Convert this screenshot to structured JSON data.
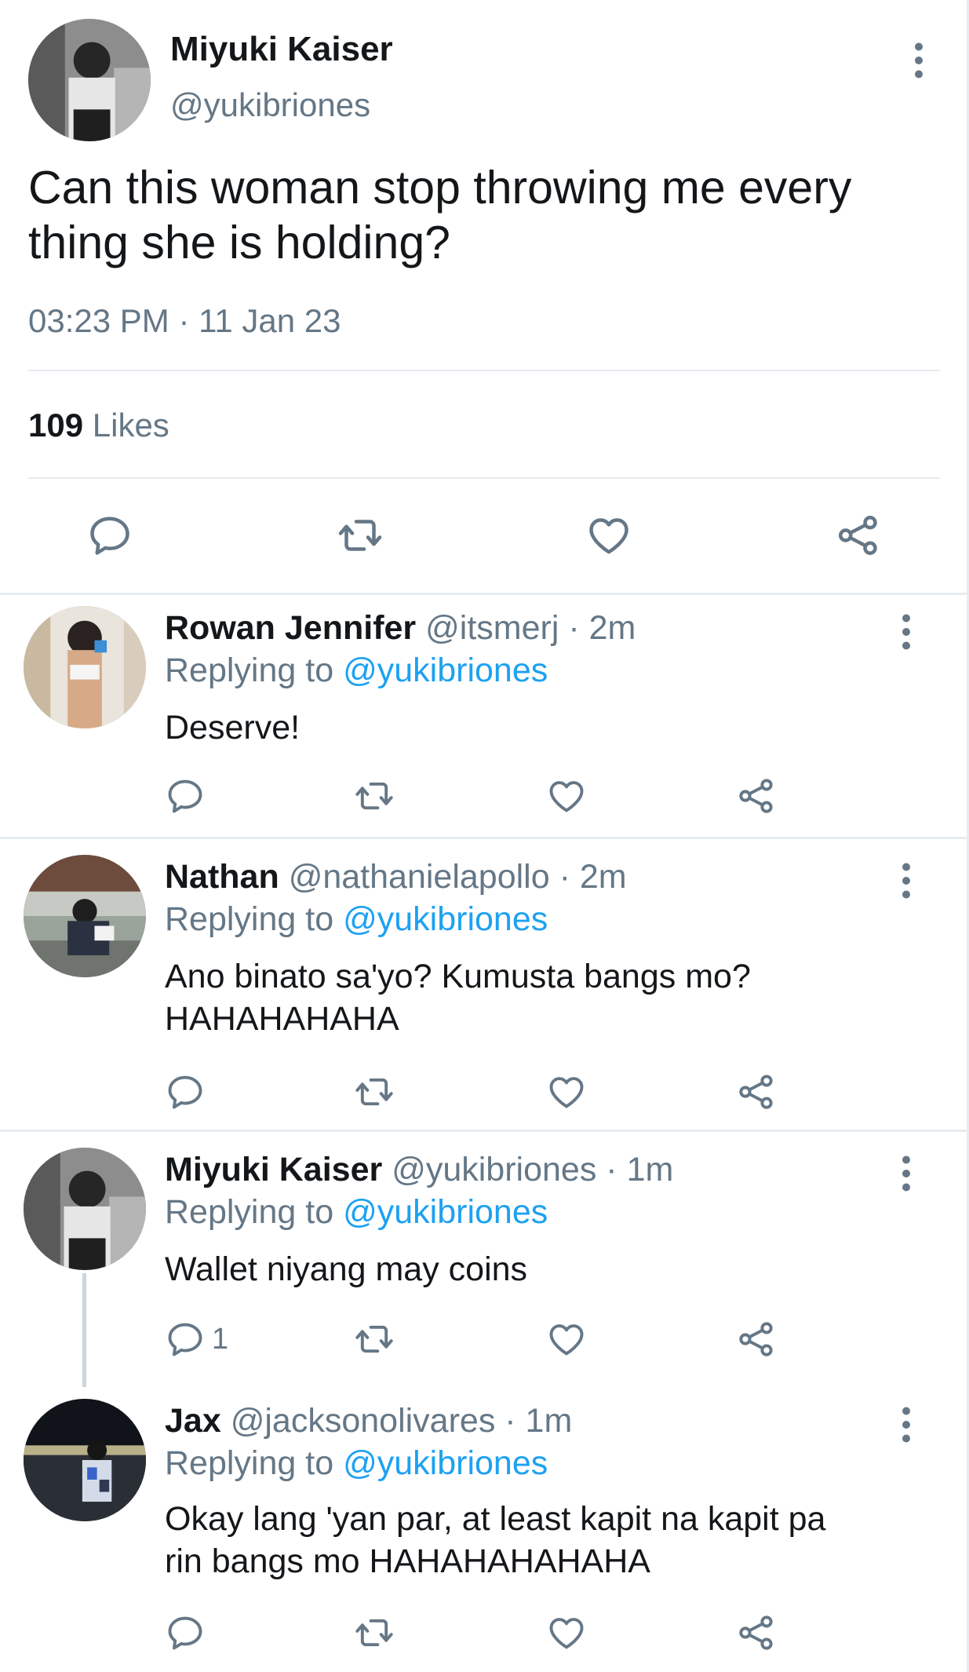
{
  "main_tweet": {
    "author_name": "Miyuki Kaiser",
    "author_handle": "@yukibriones",
    "text": "Can this woman stop throwing me every thing she is holding?",
    "timestamp": "03:23 PM · 11 Jan 23",
    "likes_count": "109",
    "likes_label": "Likes"
  },
  "replies": [
    {
      "name": "Rowan Jennifer",
      "handle": "@itsmerj",
      "time": "· 2m",
      "replying_label": "Replying to",
      "replying_to": "@yukibriones",
      "text": "Deserve!",
      "reply_count": ""
    },
    {
      "name": "Nathan",
      "handle": "@nathanielapollo",
      "time": "· 2m",
      "replying_label": "Replying to",
      "replying_to": "@yukibriones",
      "text": "Ano binato sa'yo? Kumusta bangs mo? HAHAHAHAHA",
      "reply_count": ""
    },
    {
      "name": "Miyuki Kaiser",
      "handle": "@yukibriones",
      "time": "· 1m",
      "replying_label": "Replying to",
      "replying_to": "@yukibriones",
      "text": "Wallet niyang may coins",
      "reply_count": "1"
    },
    {
      "name": "Jax",
      "handle": "@jacksonolivares",
      "time": "· 1m",
      "replying_label": "Replying to",
      "replying_to": "@yukibriones",
      "text": "Okay lang 'yan par, at least kapit na kapit pa rin bangs mo HAHAHAHAHAHA",
      "reply_count": ""
    }
  ],
  "colors": {
    "link": "#1da1f2",
    "secondary_text": "#657786",
    "primary_text": "#14171a",
    "divider": "#e6ecf0",
    "icon": "#657786"
  },
  "icons": [
    "more-vertical-icon",
    "reply-icon",
    "retweet-icon",
    "like-icon",
    "share-icon"
  ]
}
